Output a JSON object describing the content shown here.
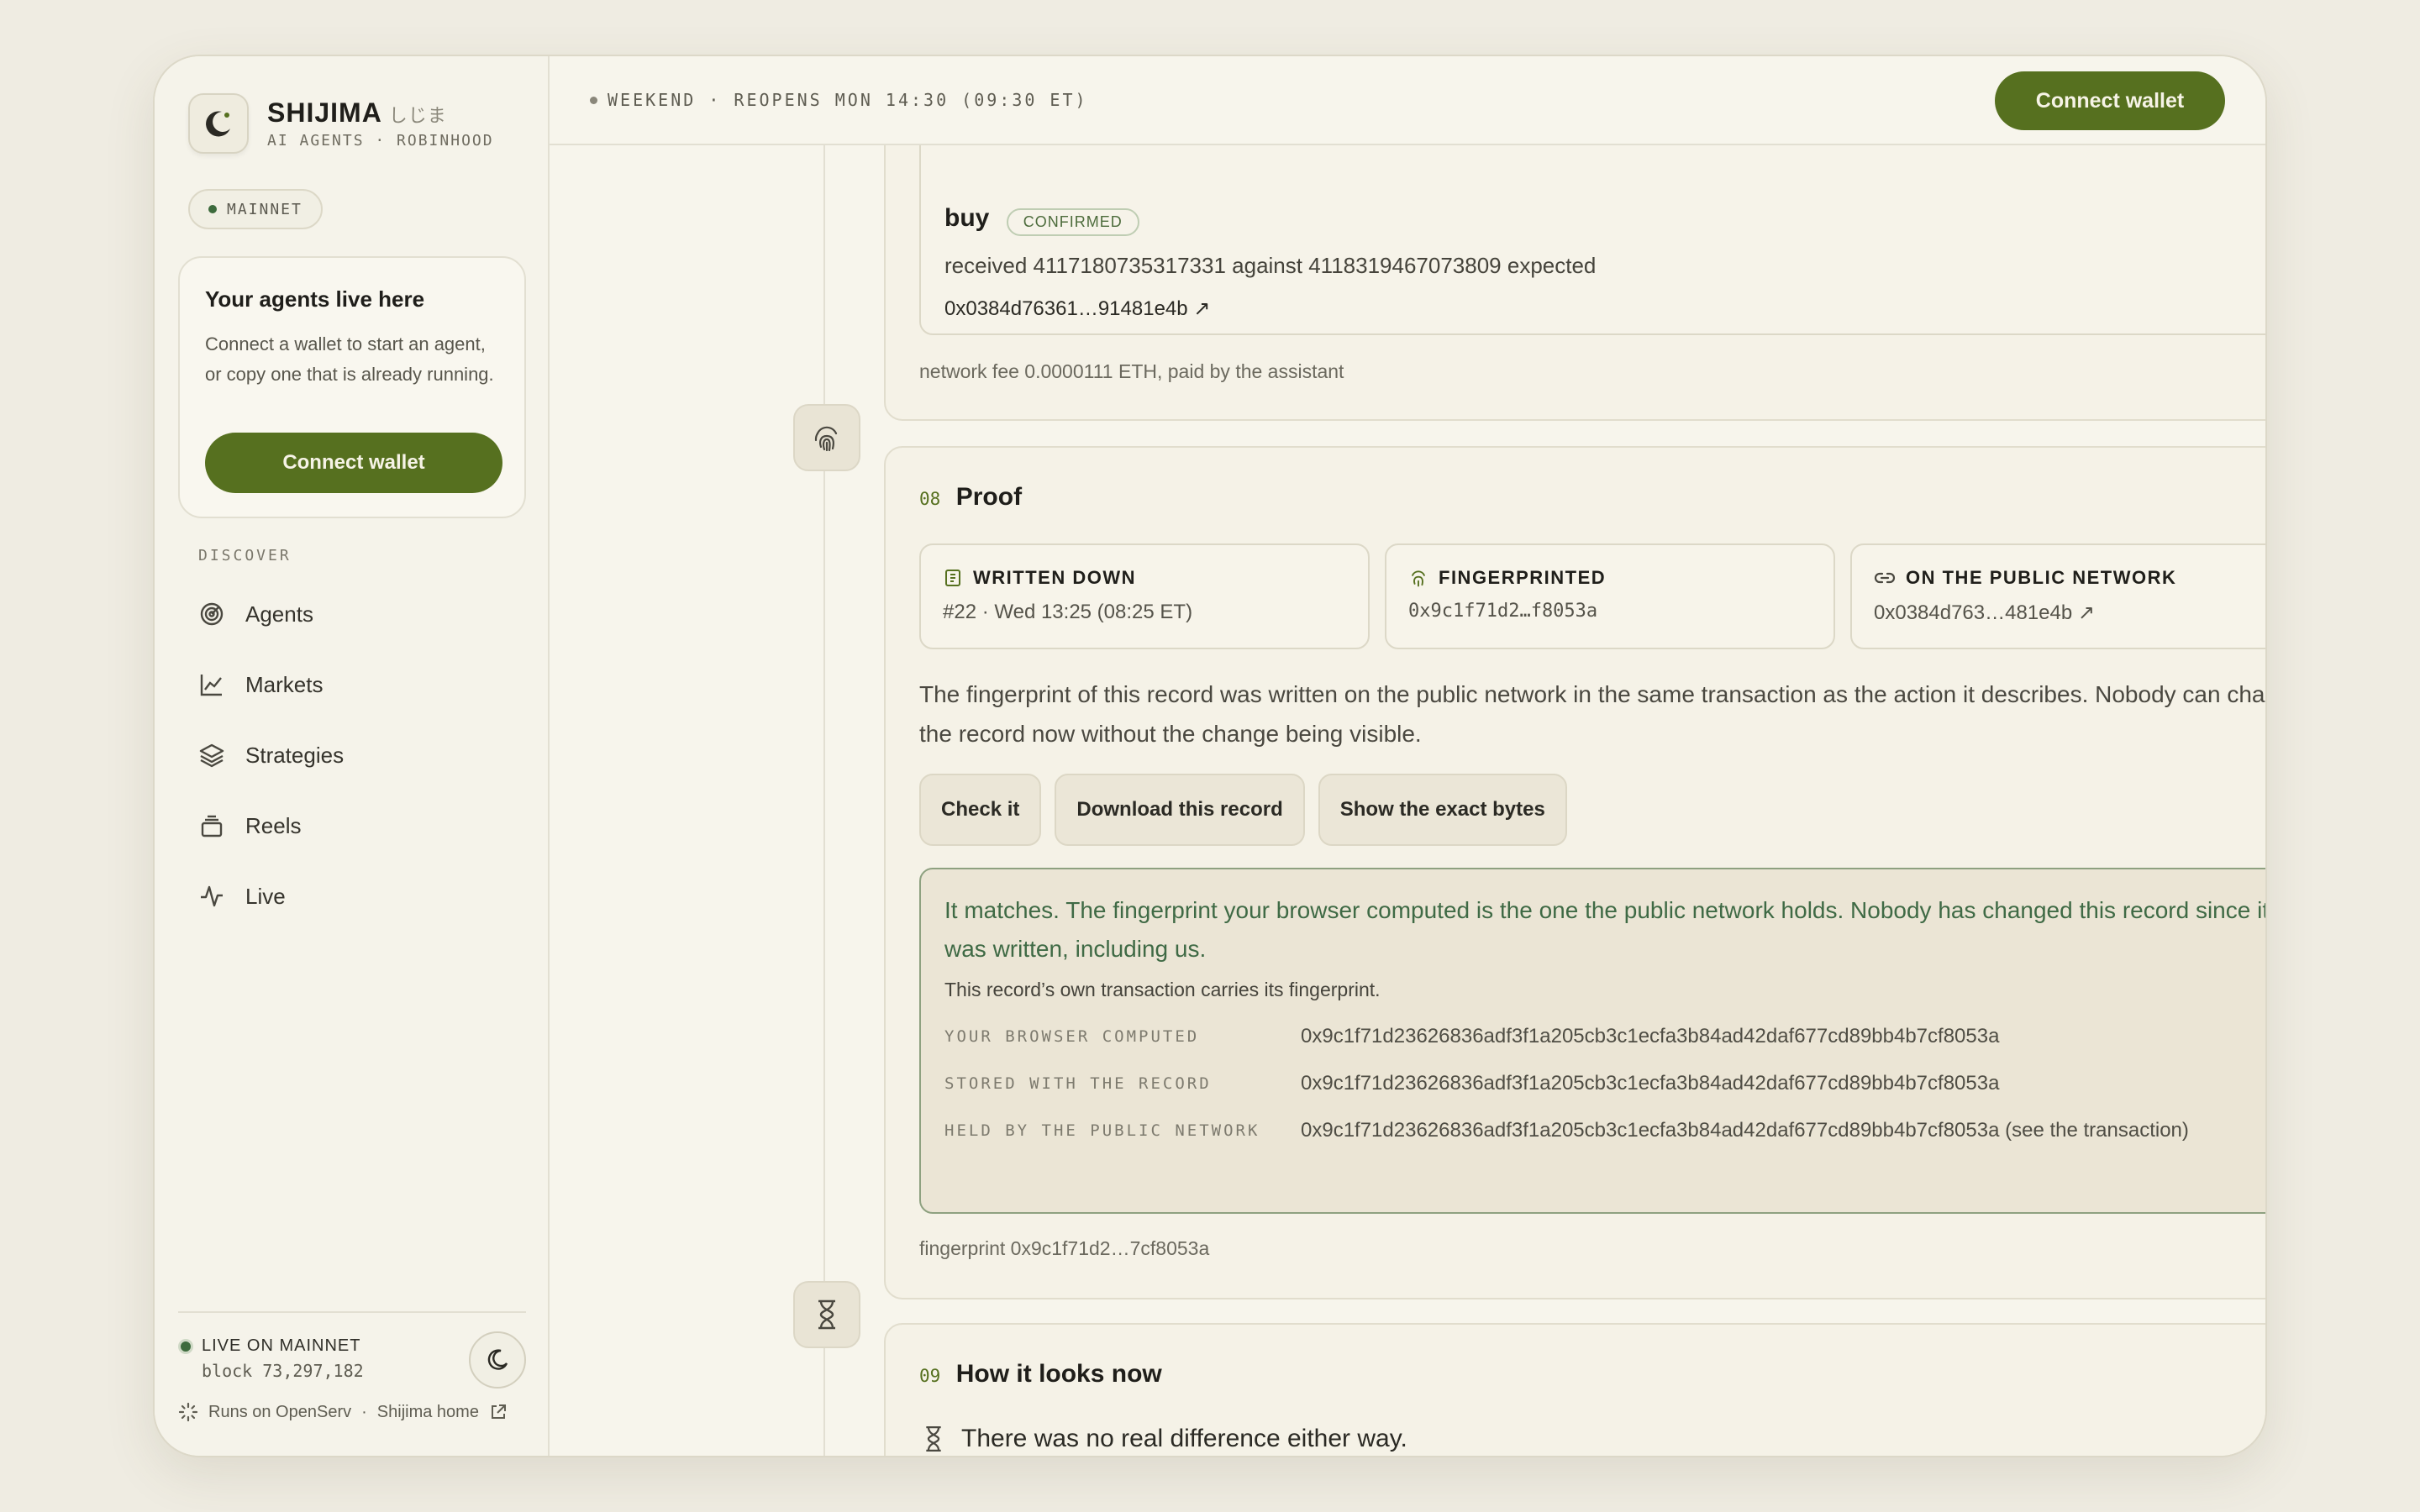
{
  "brand": {
    "name": "SHIJIMA",
    "jp": "しじま",
    "subtitle": "AI AGENTS · ROBINHOOD"
  },
  "network_pill": "MAINNET",
  "agents_card": {
    "title": "Your agents live here",
    "body": "Connect a wallet to start an agent, or copy one that is already running.",
    "button": "Connect wallet"
  },
  "discover": {
    "label": "DISCOVER",
    "items": [
      {
        "label": "Agents",
        "icon": "radar-icon"
      },
      {
        "label": "Markets",
        "icon": "line-chart-icon"
      },
      {
        "label": "Strategies",
        "icon": "layers-icon"
      },
      {
        "label": "Reels",
        "icon": "stack-icon"
      },
      {
        "label": "Live",
        "icon": "activity-icon"
      }
    ]
  },
  "footer": {
    "live_label": "LIVE ON MAINNET",
    "block": "block 73,297,182",
    "runs_on": "Runs on OpenServ",
    "separator": "·",
    "home_link": "Shijima home"
  },
  "topbar": {
    "market_status": "WEEKEND · REOPENS MON 14:30 (09:30 ET)",
    "connect_button": "Connect wallet"
  },
  "step7": {
    "action": "buy",
    "badge": "CONFIRMED",
    "received_text": "received 4117180735317331 against 4118319467073809 expected",
    "tx_link": "0x0384d76361…91481e4b ↗",
    "fee": "network fee 0.0000111 ETH, paid by the assistant"
  },
  "step8": {
    "number": "08",
    "title": "Proof",
    "boxes": [
      {
        "label": "WRITTEN DOWN",
        "value": "#22 · Wed 13:25 (08:25 ET)",
        "icon": "ledger-icon"
      },
      {
        "label": "FINGERPRINTED",
        "value": "0x9c1f71d2…f8053a",
        "icon": "fingerprint-icon"
      },
      {
        "label": "ON THE PUBLIC NETWORK",
        "value": "0x0384d763…481e4b ↗",
        "icon": "link-icon"
      }
    ],
    "explain": "The fingerprint of this record was written on the public network in the same transaction as the action it describes. Nobody can change the record now without the change being visible.",
    "actions": [
      "Check it",
      "Download this record",
      "Show the exact bytes"
    ],
    "match": {
      "headline": "It matches. The fingerprint your browser computed is the one the public network holds. Nobody has changed this record since it was written, including us.",
      "sub": "This record’s own transaction carries its fingerprint.",
      "rows": [
        {
          "key": "YOUR BROWSER COMPUTED",
          "value": "0x9c1f71d23626836adf3f1a205cb3c1ecfa3b84ad42daf677cd89bb4b7cf8053a"
        },
        {
          "key": "STORED WITH THE RECORD",
          "value": "0x9c1f71d23626836adf3f1a205cb3c1ecfa3b84ad42daf677cd89bb4b7cf8053a"
        },
        {
          "key": "HELD BY THE PUBLIC NETWORK",
          "value": "0x9c1f71d23626836adf3f1a205cb3c1ecfa3b84ad42daf677cd89bb4b7cf8053a (see the transaction)"
        }
      ]
    },
    "footer": "fingerprint 0x9c1f71d2…7cf8053a"
  },
  "step9": {
    "number": "09",
    "title": "How it looks now",
    "text": "There was no real difference either way."
  },
  "colors": {
    "accent": "#56701f",
    "match_text": "#3f6a45",
    "background": "#efece2"
  }
}
